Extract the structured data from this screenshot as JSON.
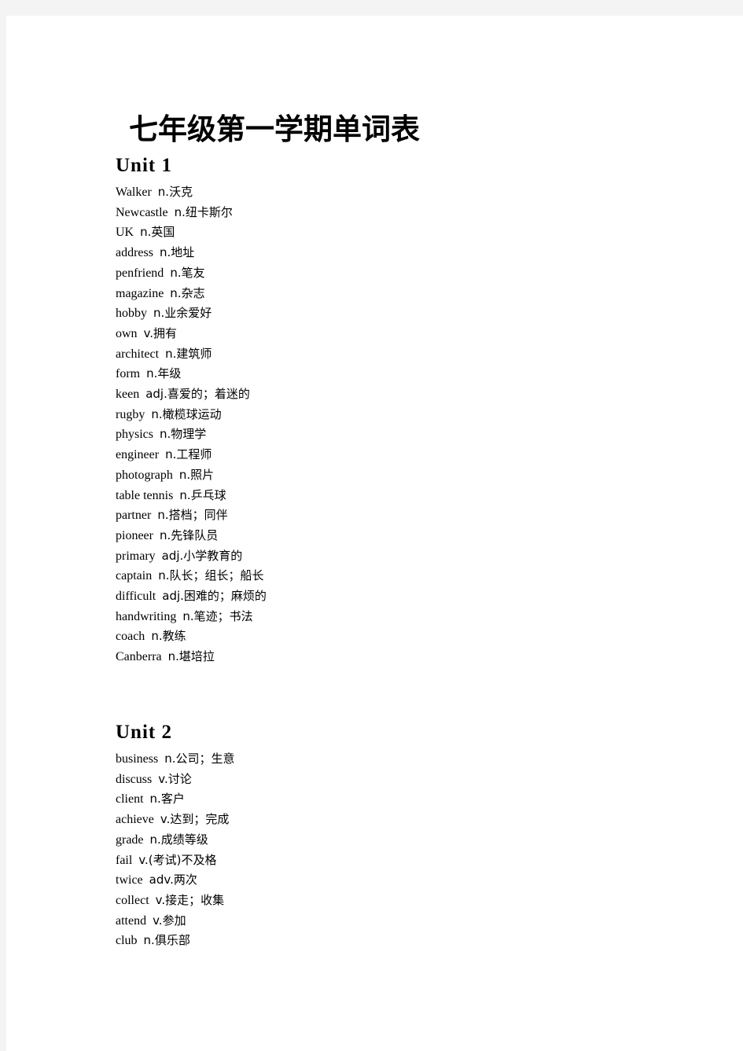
{
  "document": {
    "title": "七年级第一学期单词表"
  },
  "units": [
    {
      "heading": "Unit 1",
      "entries": [
        {
          "term": "Walker",
          "pos": "n.",
          "gloss": "沃克"
        },
        {
          "term": "Newcastle",
          "pos": "n.",
          "gloss": "纽卡斯尔"
        },
        {
          "term": "UK",
          "pos": "n.",
          "gloss": "英国"
        },
        {
          "term": "address",
          "pos": "n.",
          "gloss": "地址"
        },
        {
          "term": "penfriend",
          "pos": "n.",
          "gloss": "笔友"
        },
        {
          "term": "magazine",
          "pos": "n.",
          "gloss": "杂志"
        },
        {
          "term": "hobby",
          "pos": "n.",
          "gloss": "业余爱好"
        },
        {
          "term": "own",
          "pos": "v.",
          "gloss": "拥有"
        },
        {
          "term": "architect",
          "pos": "n.",
          "gloss": "建筑师"
        },
        {
          "term": "form",
          "pos": "n.",
          "gloss": "年级"
        },
        {
          "term": "keen",
          "pos": "adj.",
          "gloss": "喜爱的；着迷的"
        },
        {
          "term": "rugby",
          "pos": "n.",
          "gloss": "橄榄球运动"
        },
        {
          "term": "physics",
          "pos": "n.",
          "gloss": "物理学"
        },
        {
          "term": "engineer",
          "pos": "n.",
          "gloss": "工程师"
        },
        {
          "term": "photograph",
          "pos": "n.",
          "gloss": "照片"
        },
        {
          "term": "table tennis",
          "pos": "n.",
          "gloss": "乒乓球"
        },
        {
          "term": "partner",
          "pos": "n.",
          "gloss": "搭档；同伴"
        },
        {
          "term": "pioneer",
          "pos": "n.",
          "gloss": "先锋队员"
        },
        {
          "term": "primary",
          "pos": "adj.",
          "gloss": "小学教育的"
        },
        {
          "term": "captain",
          "pos": "n.",
          "gloss": "队长；组长；船长"
        },
        {
          "term": "difficult",
          "pos": "adj.",
          "gloss": "困难的；麻烦的"
        },
        {
          "term": "handwriting",
          "pos": "n.",
          "gloss": "笔迹；书法"
        },
        {
          "term": "coach",
          "pos": "n.",
          "gloss": "教练"
        },
        {
          "term": "Canberra",
          "pos": "n.",
          "gloss": "堪培拉"
        }
      ]
    },
    {
      "heading": "Unit 2",
      "entries": [
        {
          "term": "business",
          "pos": "n.",
          "gloss": "公司；生意"
        },
        {
          "term": "discuss",
          "pos": "v.",
          "gloss": "讨论"
        },
        {
          "term": "client",
          "pos": "n.",
          "gloss": "客户"
        },
        {
          "term": "achieve",
          "pos": "v.",
          "gloss": "达到；完成"
        },
        {
          "term": "grade",
          "pos": "n.",
          "gloss": "成绩等级"
        },
        {
          "term": "fail",
          "pos": "v.",
          "gloss": "(考试)不及格"
        },
        {
          "term": "twice",
          "pos": "adv.",
          "gloss": "两次"
        },
        {
          "term": "collect",
          "pos": "v.",
          "gloss": "接走；收集"
        },
        {
          "term": "attend",
          "pos": "v.",
          "gloss": "参加"
        },
        {
          "term": "club",
          "pos": "n.",
          "gloss": "俱乐部"
        }
      ]
    }
  ]
}
